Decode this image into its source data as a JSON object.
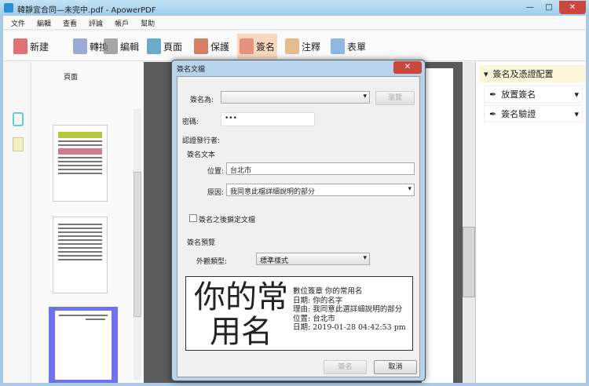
{
  "window": {
    "title": "韓靜宜合同—未完中.pdf - ApowerPDF",
    "min": "—",
    "max": "□",
    "close": "✕"
  },
  "menu": [
    "文件",
    "編輯",
    "查看",
    "評論",
    "帳戶",
    "幫助"
  ],
  "toolbar": [
    {
      "label": "新建",
      "color": "#d9434a"
    },
    {
      "label": "轉換",
      "color": "#7c8fc9"
    },
    {
      "label": "編輯",
      "color": "#8a8a8a"
    },
    {
      "label": "頁面",
      "color": "#3a8fb9"
    },
    {
      "label": "保護",
      "color": "#c9583a"
    },
    {
      "label": "簽名",
      "color": "#e07a6a"
    },
    {
      "label": "注釋",
      "color": "#e0a46a"
    },
    {
      "label": "表單",
      "color": "#6aa0d9"
    }
  ],
  "left_panel": {
    "title": "頁面"
  },
  "right_panel": {
    "header": "簽名及憑證配置",
    "items": [
      "放置簽名",
      "簽名驗證"
    ]
  },
  "dialog": {
    "title": "簽名文檔",
    "sign_as_label": "簽名為:",
    "sign_as_value": "",
    "browse_button": "瀏覽",
    "password_label": "密碼:",
    "password_value": "•••",
    "issuer_label": "認證發行者:",
    "sig_text_label": "簽名文本",
    "location_label": "位置:",
    "location_value": "台北市",
    "reason_label": "原因:",
    "reason_value": "我同意此檔詳細說明的部分",
    "lock_label": "簽名之後鎖定文檔",
    "lock_checked": false,
    "preview_label": "簽名預覽",
    "appearance_label": "外觀類型:",
    "appearance_value": "標準樣式",
    "preview": {
      "name": "你的常用名",
      "lines": [
        "數位簽章 你的常用名",
        "日期: 你的名字",
        "理由: 我同意此選詳細說明的部分",
        "位置: 台北市",
        "日期: 2019-01-28 04:42:53 pm"
      ]
    },
    "sign_button": "簽名",
    "cancel_button": "取消"
  }
}
